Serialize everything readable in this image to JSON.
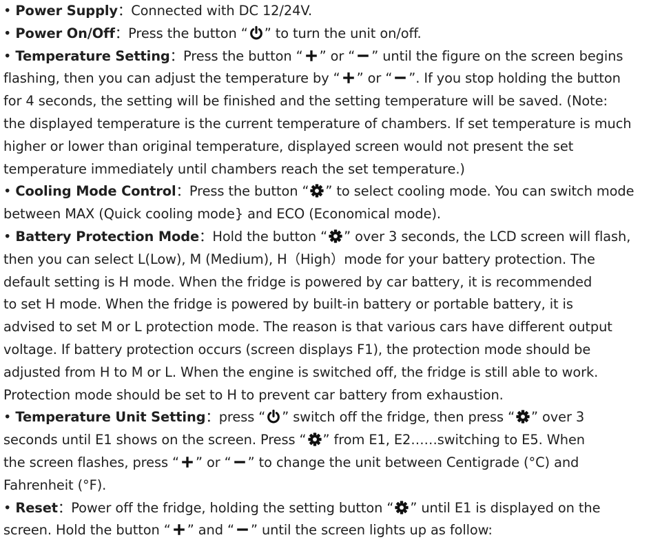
{
  "colors": {
    "text": "#1f1f1f",
    "background": "#ffffff"
  },
  "icons": {
    "power": "power-icon",
    "plus": "plus-icon",
    "minus": "minus-icon",
    "gear": "gear-icon"
  },
  "lines": [
    [
      {
        "t": "• "
      },
      {
        "b": "Power Supply"
      },
      {
        "t": "：Connected with DC 12/24V."
      }
    ],
    [
      {
        "t": "• "
      },
      {
        "b": "Power On/Off"
      },
      {
        "t": "：Press the button “"
      },
      {
        "i": "power"
      },
      {
        "t": "” to turn the unit on/off."
      }
    ],
    [
      {
        "t": "• "
      },
      {
        "b": "Temperature Setting"
      },
      {
        "t": "：Press the button “"
      },
      {
        "i": "plus"
      },
      {
        "t": "” or “"
      },
      {
        "i": "minus"
      },
      {
        "t": "” until the figure on the screen begins"
      }
    ],
    [
      {
        "t": "flashing, then you can adjust the temperature by “"
      },
      {
        "i": "plus"
      },
      {
        "t": "” or “"
      },
      {
        "i": "minus"
      },
      {
        "t": "”. If you stop holding the button"
      }
    ],
    [
      {
        "t": "for 4 seconds, the setting will be finished and the setting temperature will be saved. (Note:"
      }
    ],
    [
      {
        "t": "the displayed temperature is the current temperature of chambers. If set temperature is much"
      }
    ],
    [
      {
        "t": "higher or lower than original temperature, displayed screen would not present the set"
      }
    ],
    [
      {
        "t": "temperature immediately until chambers reach the set temperature.)"
      }
    ],
    [
      {
        "t": "• "
      },
      {
        "b": "Cooling Mode Control"
      },
      {
        "t": "：Press the button “"
      },
      {
        "i": "gear"
      },
      {
        "t": "” to select cooling mode. You can switch mode"
      }
    ],
    [
      {
        "t": "between MAX (Quick cooling mode} and ECO (Economical mode)."
      }
    ],
    [
      {
        "t": "• "
      },
      {
        "b": "Battery Protection Mode"
      },
      {
        "t": "：Hold the button “"
      },
      {
        "i": "gear"
      },
      {
        "t": "” over 3 seconds, the LCD screen will flash,"
      }
    ],
    [
      {
        "t": "then you can select L(Low), M (Medium), H（High）mode for your battery protection. The"
      }
    ],
    [
      {
        "t": "default setting is H mode. When the fridge is powered by car battery, it is recommended"
      }
    ],
    [
      {
        "t": "to set H mode. When the fridge is powered by built-in battery or portable battery, it is"
      }
    ],
    [
      {
        "t": "advised to set M or L protection mode. The reason is that various cars have different output"
      }
    ],
    [
      {
        "t": "voltage. If battery protection occurs (screen displays F1), the protection mode should be"
      }
    ],
    [
      {
        "t": "adjusted from H to M or L. When the engine is switched off, the fridge is still able to work."
      }
    ],
    [
      {
        "t": "Protection mode should be set to H to prevent car battery from exhaustion."
      }
    ],
    [
      {
        "t": "• "
      },
      {
        "b": "Temperature Unit Setting"
      },
      {
        "t": "：press “"
      },
      {
        "i": "power"
      },
      {
        "t": "” switch off the fridge, then press “"
      },
      {
        "i": "gear"
      },
      {
        "t": "” over 3"
      }
    ],
    [
      {
        "t": "seconds until E1 shows on the screen. Press “"
      },
      {
        "i": "gear"
      },
      {
        "t": "” from E1, E2……switching to E5. When"
      }
    ],
    [
      {
        "t": "the screen flashes, press “"
      },
      {
        "i": "plus"
      },
      {
        "t": "” or “"
      },
      {
        "i": "minus"
      },
      {
        "t": "” to change the unit between Centigrade (°C) and"
      }
    ],
    [
      {
        "t": "Fahrenheit (°F)."
      }
    ],
    [
      {
        "t": "• "
      },
      {
        "b": "Reset"
      },
      {
        "t": "：Power off the fridge, holding the setting button “"
      },
      {
        "i": "gear"
      },
      {
        "t": "” until E1 is displayed on the"
      }
    ],
    [
      {
        "t": "screen. Hold the button “"
      },
      {
        "i": "plus"
      },
      {
        "t": "” and “"
      },
      {
        "i": "minus"
      },
      {
        "t": "” until the screen lights up as follow:"
      }
    ]
  ]
}
